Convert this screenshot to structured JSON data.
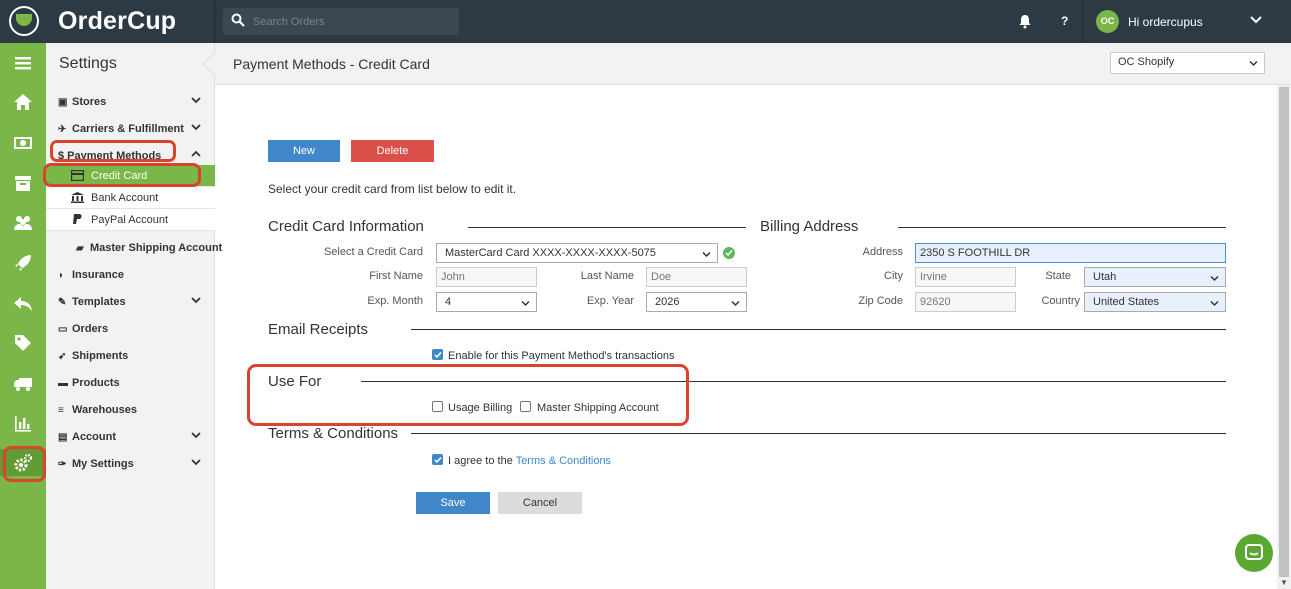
{
  "app": {
    "name": "OrderCup"
  },
  "topbar": {
    "search_placeholder": "Search Orders",
    "help_label": "?",
    "avatar_initials": "OC",
    "greeting": "Hi ordercupus"
  },
  "rail": {
    "items": [
      "menu-icon",
      "home-icon",
      "money-icon",
      "archive-icon",
      "users-icon",
      "rocket-icon",
      "reply-icon",
      "tag-icon",
      "truck-icon",
      "chart-icon",
      "cogs-icon"
    ],
    "active": "cogs-icon"
  },
  "sidebar": {
    "title": "Settings",
    "items": [
      {
        "label": "Stores",
        "icon": "gift-icon",
        "expandable": true
      },
      {
        "label": "Carriers & Fulfillment",
        "icon": "plane-icon",
        "expandable": true
      },
      {
        "label": "$ Payment Methods",
        "icon": "dollar-icon",
        "expanded": true
      },
      {
        "label": "Master Shipping Account",
        "icon": "truck-icon"
      },
      {
        "label": "Insurance",
        "icon": "shield-icon"
      },
      {
        "label": "Templates",
        "icon": "edit-icon",
        "expandable": true
      },
      {
        "label": "Orders",
        "icon": "money-icon"
      },
      {
        "label": "Shipments",
        "icon": "rocket-icon"
      },
      {
        "label": "Products",
        "icon": "archive-icon"
      },
      {
        "label": "Warehouses",
        "icon": "database-icon"
      },
      {
        "label": "Account",
        "icon": "briefcase-icon",
        "expandable": true
      },
      {
        "label": "My Settings",
        "icon": "wrench-icon",
        "expandable": true
      }
    ],
    "payment_subitems": [
      {
        "label": "Credit Card",
        "icon": "credit-card-icon",
        "active": true
      },
      {
        "label": "Bank Account",
        "icon": "bank-icon"
      },
      {
        "label": "PayPal Account",
        "icon": "paypal-icon"
      }
    ]
  },
  "header": {
    "title": "Payment Methods - Credit Card",
    "store_selected": "OC Shopify"
  },
  "actions": {
    "new_label": "New",
    "delete_label": "Delete"
  },
  "intro": "Select your credit card from list below to edit it.",
  "credit_card": {
    "section_title": "Credit Card Information",
    "select_label": "Select a Credit Card",
    "select_value": "MasterCard Card XXXX-XXXX-XXXX-5075",
    "first_name_label": "First Name",
    "first_name_value": "John",
    "last_name_label": "Last Name",
    "last_name_value": "Doe",
    "exp_month_label": "Exp. Month",
    "exp_month_value": "4",
    "exp_year_label": "Exp. Year",
    "exp_year_value": "2026"
  },
  "billing": {
    "section_title": "Billing Address",
    "address_label": "Address",
    "address_value": "2350 S FOOTHILL DR",
    "city_label": "City",
    "city_value": "Irvine",
    "state_label": "State",
    "state_value": "Utah",
    "zip_label": "Zip Code",
    "zip_value": "92620",
    "country_label": "Country",
    "country_value": "United States"
  },
  "email_receipts": {
    "section_title": "Email Receipts",
    "checkbox_label": "Enable for this Payment Method's transactions",
    "checked": true
  },
  "use_for": {
    "section_title": "Use For",
    "usage_billing_label": "Usage Billing",
    "usage_billing_checked": false,
    "master_shipping_label": "Master Shipping Account",
    "master_shipping_checked": false
  },
  "terms": {
    "section_title": "Terms & Conditions",
    "agree_prefix": "I agree to the",
    "agree_link": "Terms & Conditions",
    "checked": true
  },
  "form_actions": {
    "save_label": "Save",
    "cancel_label": "Cancel"
  },
  "colors": {
    "topbar": "#2d3a44",
    "brand_green": "#7ab648",
    "primary_blue": "#3f87c9",
    "danger_red": "#d9504a",
    "highlight_red": "#d9442f"
  }
}
